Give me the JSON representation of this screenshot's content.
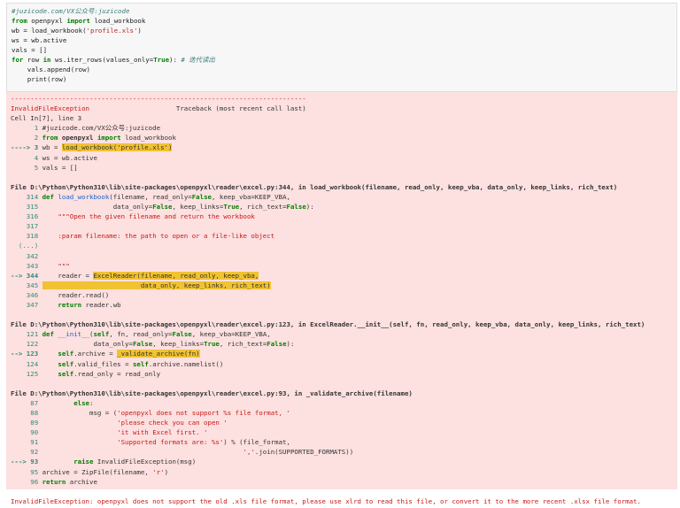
{
  "cell": {
    "prompt": "[ ]:",
    "code": [
      "#juzicode.com/VX公众号:juzicode",
      "from openpyxl import load_workbook",
      "wb = load_workbook('profile.xls')",
      "ws = wb.active",
      "vals = []",
      "for row in ws.iter_rows(values_only=True): # 迭代读出",
      "    vals.append(row)",
      "    print(row)"
    ]
  },
  "traceback": {
    "separator": "---------------------------------------------------------------------------",
    "exception": "InvalidFileException",
    "traceback_label": "Traceback (most recent call last)",
    "cell_ref": "Cell In[7], line 3",
    "frames": [
      {
        "header": "File D:\\Python\\Python310\\lib\\site-packages\\openpyxl\\reader\\excel.py:344, in load_workbook(filename, read_only, keep_vba, data_only, keep_links, rich_text)"
      },
      {
        "header": "File D:\\Python\\Python310\\lib\\site-packages\\openpyxl\\reader\\excel.py:123, in ExcelReader.__init__(self, fn, read_only, keep_vba, data_only, keep_links, rich_text)"
      },
      {
        "header": "File D:\\Python\\Python310\\lib\\site-packages\\openpyxl\\reader\\excel.py:93, in _validate_archive(filename)"
      }
    ],
    "final_error": "InvalidFileException: openpyxl does not support the old .xls file format, please use xlrd to read this file, or convert it to the more recent .xlsx file format."
  },
  "colors": {
    "output_bg": "#fde0e0",
    "highlight": "#f1c232",
    "error_red": "#c41a16",
    "keyword_green": "#008000"
  }
}
